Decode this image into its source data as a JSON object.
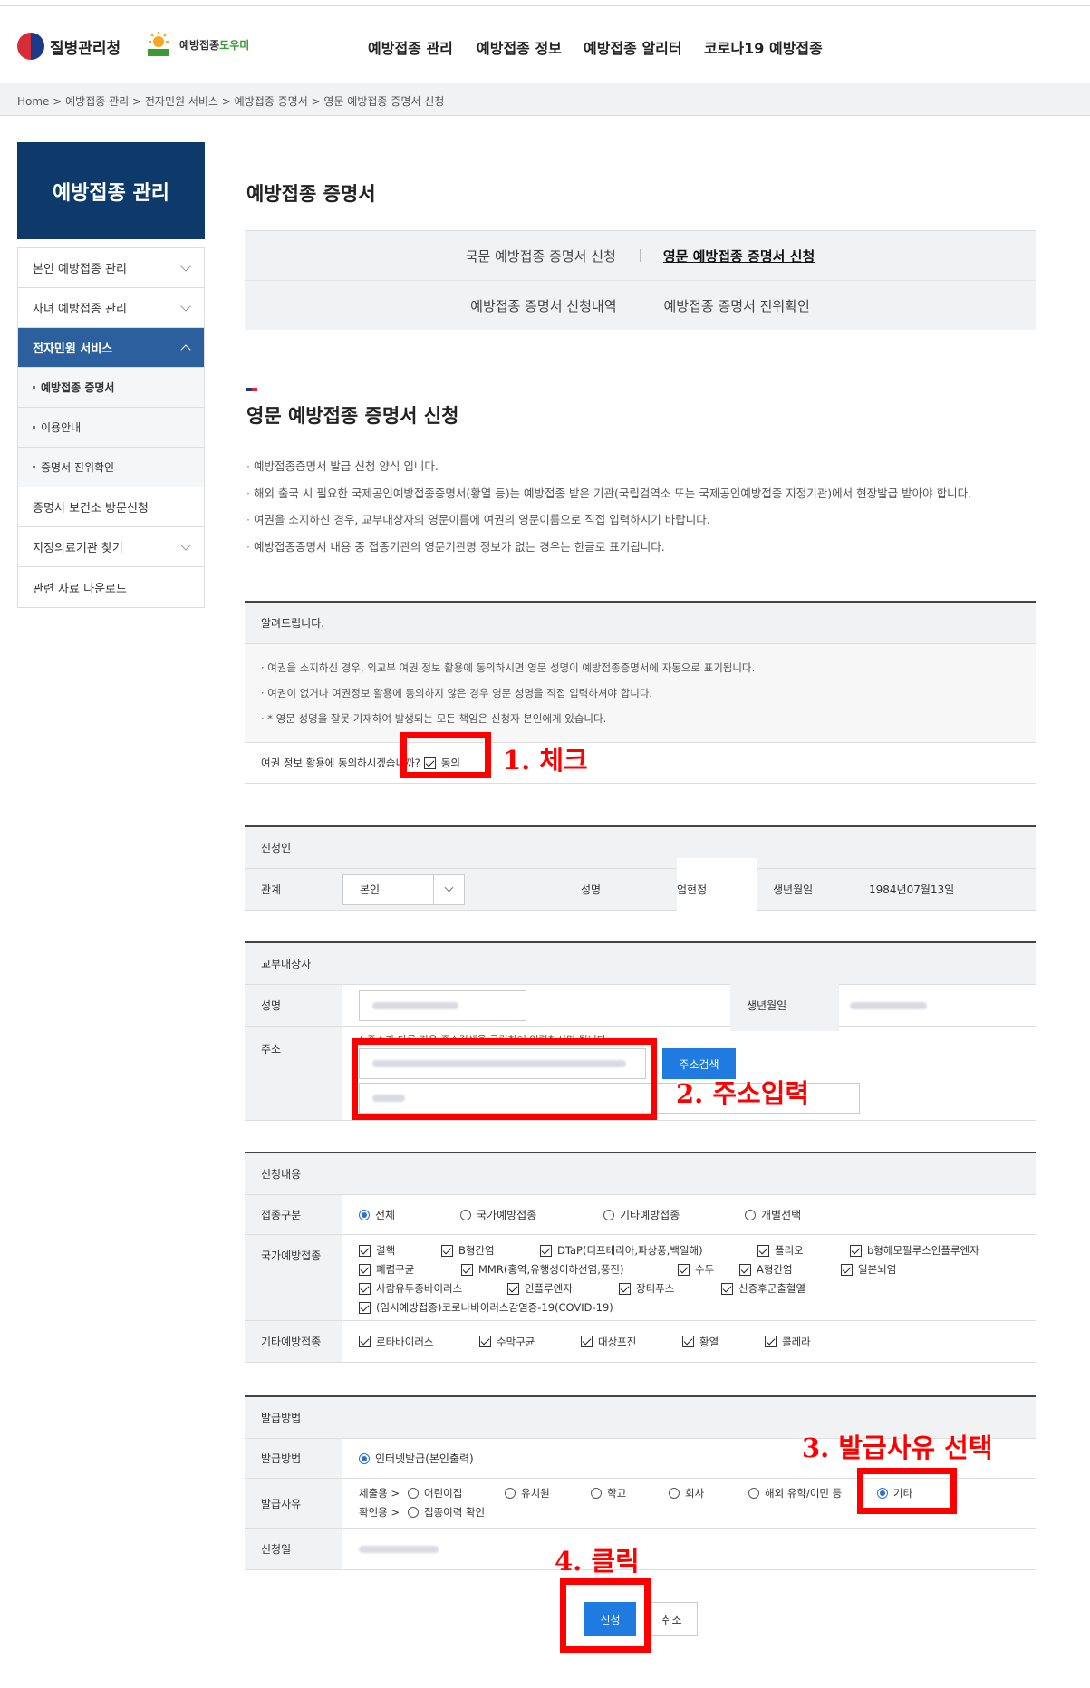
{
  "header": {
    "logo_kdca": "질병관리청",
    "logo_helper_1": "예방접종",
    "logo_helper_2": "도우미",
    "nav": [
      "예방접종 관리",
      "예방접종 정보",
      "예방접종 알리터",
      "코로나19 예방접종"
    ]
  },
  "breadcrumb": "Home  >  예방접종 관리  >  전자민원 서비스  >  예방접종 증명서  >  영문 예방접종 증명서 신청",
  "sidebar": {
    "title": "예방접종 관리",
    "items": [
      {
        "label": "본인 예방접종 관리"
      },
      {
        "label": "자녀 예방접종 관리"
      },
      {
        "label": "전자민원 서비스"
      },
      {
        "label": "예방접종 증명서"
      },
      {
        "label": "이용안내"
      },
      {
        "label": "증명서 진위확인"
      },
      {
        "label": "증명서 보건소 방문신청"
      },
      {
        "label": "지정의료기관 찾기"
      },
      {
        "label": "관련 자료 다운로드"
      }
    ]
  },
  "page_title": "예방접종 증명서",
  "tabs": [
    "국문 예방접종 증명서 신청",
    "영문 예방접종 증명서 신청",
    "예방접종 증명서 신청내역",
    "예방접종 증명서 진위확인"
  ],
  "section_title": "영문 예방접종 증명서 신청",
  "notes": [
    "예방접종증명서 발급 신청 양식 입니다.",
    "해외 출국 시 필요한 국제공인예방접종증명서(황열 등)는 예방접종 받은 기관(국립검역소 또는 국제공인예방접종 지정기관)에서 현장발급 받아야 합니다.",
    "여권을 소지하신 경우, 교부대상자의 영문이름에 여권의 영문이름으로 직접 입력하시기 바랍니다.",
    "예방접종증명서 내용 중 접종기관의 영문기관명 정보가 없는 경우는 한글로 표기됩니다."
  ],
  "notice": {
    "header": "알려드립니다.",
    "lines": [
      "· 여권을 소지하신 경우, 외교부 여권 정보 활용에 동의하시면 영문 성명이 예방접종증명서에 자동으로 표기됩니다.",
      "· 여권이 없거나 여권정보 활용에 동의하지 않은 경우 영문 성명을 직접 입력하셔야 합니다.",
      "· * 영문 성명을 잘못 기재하여 발생되는 모든 책임은 신청자 본인에게 있습니다."
    ],
    "consent_question": "여권 정보 활용에 동의하시겠습니까?",
    "consent_label": "동의"
  },
  "applicant": {
    "header": "신청인",
    "relation_label": "관계",
    "relation_value": "본인",
    "name_label": "성명",
    "name_value": "엄현정",
    "birth_label": "생년월일",
    "birth_value": "1984년07월13일"
  },
  "recipient": {
    "header": "교부대상자",
    "name_label": "성명",
    "birth_label": "생년월일",
    "address_label": "주소",
    "address_hint": "* 주소가 다른 경우 주소검색을 클릭하여 입력하시면 됩니다.",
    "search_button": "주소검색"
  },
  "content": {
    "header": "신청내용",
    "type_label": "접종구분",
    "type_options": [
      "전체",
      "국가예방접종",
      "기타예방접종",
      "개별선택"
    ],
    "type_selected": "전체",
    "national_label": "국가예방접종",
    "national": [
      "결핵",
      "B형간염",
      "DTaP(디프테리아,파상풍,백일해)",
      "폴리오",
      "b형헤모필루스인플루엔자",
      "폐렴구균",
      "MMR(홍역,유행성이하선염,풍진)",
      "수두",
      "A형간염",
      "일본뇌염",
      "사람유두종바이러스",
      "인플루엔자",
      "장티푸스",
      "신증후군출혈열",
      "(임시예방접종)코로나바이러스감염증-19(COVID-19)"
    ],
    "other_label": "기타예방접종",
    "other": [
      "로타바이러스",
      "수막구균",
      "대상포진",
      "황열",
      "콜레라"
    ]
  },
  "issue": {
    "header": "발급방법",
    "method_label": "발급방법",
    "method_value": "인터넷발급(본인출력)",
    "reason_label": "발급사유",
    "submit_prefix": "제출용 >",
    "submit_options": [
      "어린이집",
      "유치원",
      "학교",
      "회사",
      "해외 유학/이민 등",
      "기타"
    ],
    "reason_selected": "기타",
    "confirm_prefix": "확인용 >",
    "confirm_option": "접종이력 확인",
    "date_label": "신청일"
  },
  "buttons": {
    "apply": "신청",
    "cancel": "취소"
  },
  "annotations": {
    "step1": "1. 체크",
    "step2": "2. 주소입력",
    "step3": "3. 발급사유 선택",
    "step4": "4. 클릭"
  },
  "colors": {
    "navy": "#0e3a6b",
    "active_blue": "#2b5f9e",
    "button_blue": "#1f7be0",
    "annotation_red": "#ff0000"
  }
}
